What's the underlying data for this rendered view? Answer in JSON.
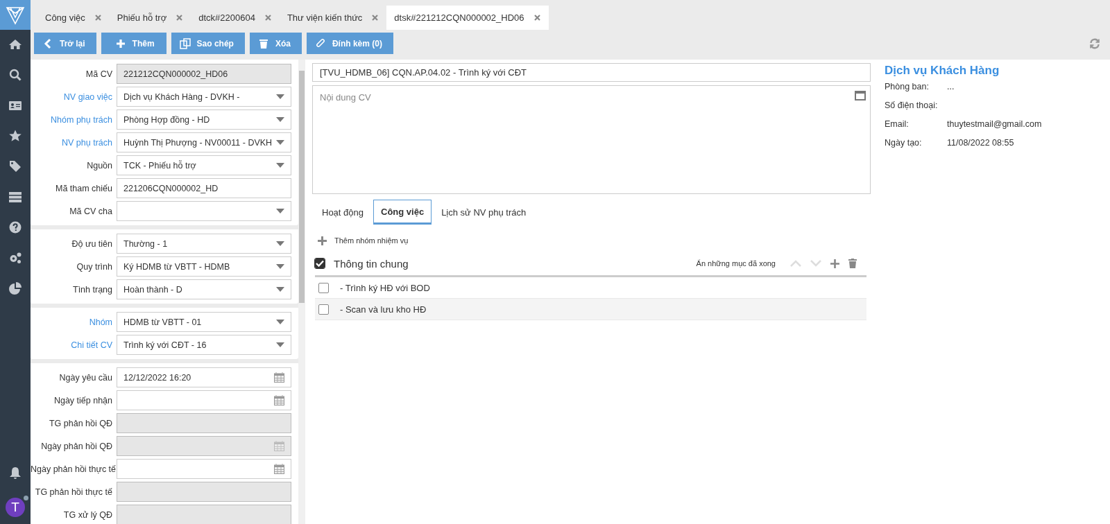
{
  "tabs": [
    {
      "label": "Công việc",
      "selected": false
    },
    {
      "label": "Phiếu hỗ trợ",
      "selected": false
    },
    {
      "label": "dtck#2200604",
      "selected": false
    },
    {
      "label": "Thư viện kiến thức",
      "selected": false
    },
    {
      "label": "dtsk#221212CQN000002_HD06",
      "selected": true
    }
  ],
  "toolbar": [
    {
      "label": "Trở lại",
      "kind": "back"
    },
    {
      "label": "Thêm",
      "kind": "add"
    },
    {
      "label": "Sao chép",
      "kind": "copy"
    },
    {
      "label": "Xóa",
      "kind": "delete"
    },
    {
      "label": "Đính kèm (0)",
      "kind": "attach"
    }
  ],
  "form_sections": [
    {
      "fields": [
        {
          "label": "Mã CV",
          "kind": "text",
          "linked": false,
          "disabled": true,
          "value": "221212CQN000002_HD06"
        },
        {
          "label": "NV giao việc",
          "kind": "select",
          "linked": true,
          "disabled": false,
          "value": "Dịch vụ Khách Hàng - DVKH -"
        },
        {
          "label": "Nhóm phụ trách",
          "kind": "select",
          "linked": true,
          "disabled": false,
          "value": "Phòng Hợp đồng - HD"
        },
        {
          "label": "NV phụ trách",
          "kind": "select",
          "linked": true,
          "disabled": false,
          "value": "Huỳnh Thị Phượng - NV00011 - DVKH"
        },
        {
          "label": "Nguồn",
          "kind": "select",
          "linked": false,
          "disabled": false,
          "value": "TCK - Phiếu hỗ trợ"
        },
        {
          "label": "Mã tham chiếu",
          "kind": "text",
          "linked": false,
          "disabled": false,
          "value": "221206CQN000002_HD"
        },
        {
          "label": "Mã CV cha",
          "kind": "select",
          "linked": false,
          "disabled": false
        }
      ]
    },
    {
      "fields": [
        {
          "label": "Độ ưu tiên",
          "kind": "select",
          "linked": false,
          "disabled": false,
          "value": "Thường - 1"
        },
        {
          "label": "Quy trình",
          "kind": "select",
          "linked": false,
          "disabled": false,
          "value": "Ký HDMB từ VBTT - HDMB"
        },
        {
          "label": "Tình trạng",
          "kind": "select",
          "linked": false,
          "disabled": false,
          "value": "Hoàn thành - D"
        }
      ]
    },
    {
      "fields": [
        {
          "label": "Nhóm",
          "kind": "select",
          "linked": true,
          "disabled": false,
          "value": "HDMB từ VBTT - 01"
        },
        {
          "label": "Chi tiết CV",
          "kind": "select",
          "linked": true,
          "disabled": false,
          "value": "Trình ký với CĐT - 16"
        }
      ]
    },
    {
      "fields": [
        {
          "label": "Ngày yêu cầu",
          "kind": "date",
          "linked": false,
          "disabled": false,
          "value": "12/12/2022 16:20"
        },
        {
          "label": "Ngày tiếp nhận",
          "kind": "date",
          "linked": false,
          "disabled": false
        },
        {
          "label": "TG phản hồi QĐ",
          "kind": "text",
          "linked": false,
          "disabled": true
        },
        {
          "label": "Ngày phản hồi QĐ",
          "kind": "date",
          "linked": false,
          "disabled": true
        },
        {
          "label": "Ngày phản hồi thực tế",
          "kind": "date",
          "linked": false,
          "disabled": false
        },
        {
          "label": "TG phản hồi thực tế",
          "kind": "text",
          "linked": false,
          "disabled": true
        },
        {
          "label": "TG xử lý QĐ",
          "kind": "text",
          "linked": false,
          "disabled": true
        }
      ]
    }
  ],
  "task_title": "[TVU_HDMB_06] CQN.AP.04.02 - Trình ký với CĐT",
  "content": {
    "placeholder": "Nội dung CV"
  },
  "detail_tabs": [
    {
      "label": "Hoạt động",
      "selected": false
    },
    {
      "label": "Công việc",
      "selected": true
    },
    {
      "label": "Lịch sử NV phụ trách",
      "selected": false
    }
  ],
  "add_group": "Thêm nhóm nhiệm vụ",
  "checklist": {
    "title": "Thông tin chung",
    "checked": true,
    "hide_done": "Ẩn những mục đã xong",
    "items": [
      {
        "label": "- Trình ký HĐ với BOD",
        "checked": false
      },
      {
        "label": "- Scan và lưu kho HĐ",
        "checked": false
      }
    ]
  },
  "profile": {
    "name": "Dịch vụ Khách Hàng",
    "rows": [
      {
        "label": "Phòng ban:",
        "value": "..."
      },
      {
        "label": "Số điện thoại:"
      },
      {
        "label": "Email:",
        "value": "thuytestmail@gmail.com"
      },
      {
        "label": "Ngày tạo:",
        "value": "11/08/2022 08:55"
      }
    ]
  },
  "user": {
    "initial": "T"
  }
}
